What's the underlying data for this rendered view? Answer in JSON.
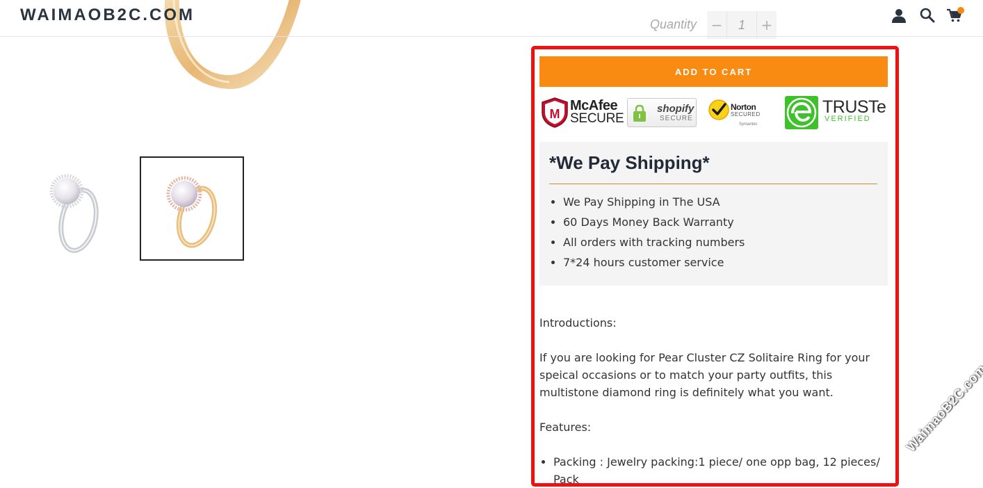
{
  "header": {
    "logo": "WAIMAOB2C.COM",
    "icons": [
      "account-icon",
      "search-icon",
      "cart-icon"
    ]
  },
  "quantity": {
    "label": "Quantity",
    "value": "1",
    "minus": "−",
    "plus": "+"
  },
  "add_to_cart": "ADD TO CART",
  "badges": {
    "mcafee_name": "McAfee",
    "mcafee_sub": "SECURE",
    "shopify_name": "shopify",
    "shopify_sub": "SECURE",
    "norton_name": "Norton",
    "norton_sub": "SECURED",
    "norton_by": "Symantec",
    "truste_name": "TRUSTe",
    "truste_sub": "VERIFIED"
  },
  "shipping": {
    "title": "*We Pay Shipping*",
    "items": [
      "We Pay Shipping in The USA",
      "60 Days Money Back Warranty",
      "All orders with tracking numbers",
      "7*24 hours customer service"
    ]
  },
  "description": {
    "intro_label": "Introductions:",
    "body": "If you are looking for Pear Cluster CZ Solitaire Ring for your speical occasions or to match your party outfits, this multistone diamond ring is definitely what you want.",
    "features_label": "Features:",
    "features": [
      "Packing : Jewelry packing:1 piece/ one opp bag, 12 pieces/ Pack"
    ]
  },
  "watermark": "WaimaoB2C.com",
  "colors": {
    "accent": "#f98a12",
    "highlight": "#ee1111",
    "logo": "#2a3440",
    "truste_green": "#3fc12b"
  }
}
